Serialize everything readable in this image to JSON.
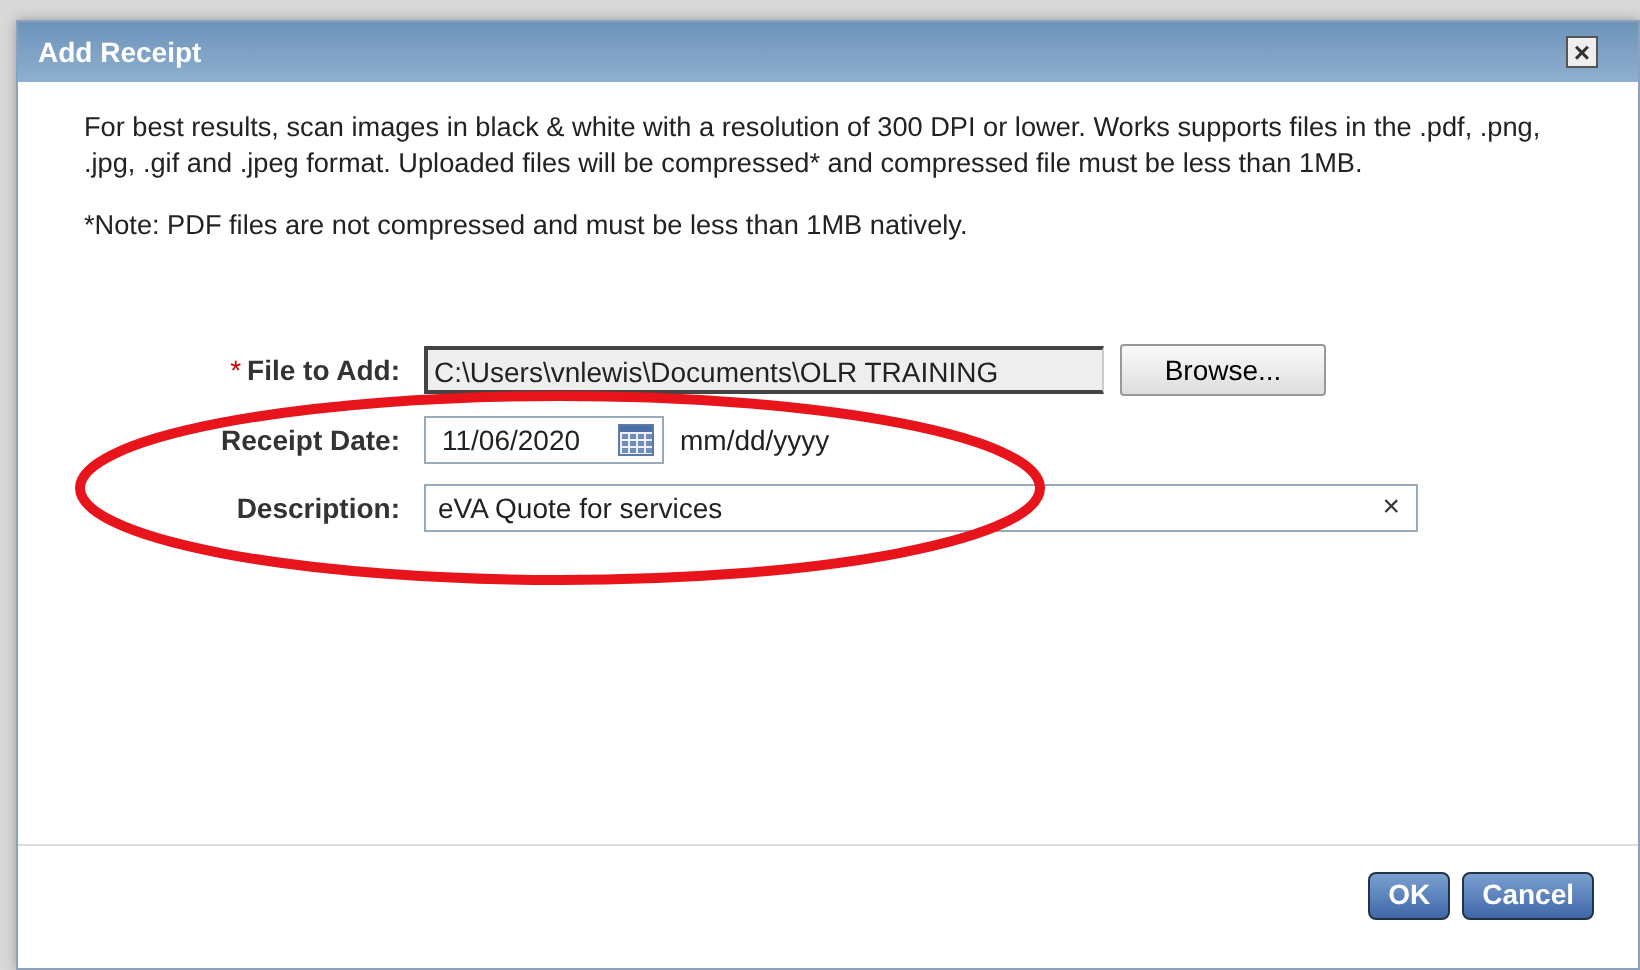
{
  "window": {
    "title": "Add Receipt",
    "close": "×"
  },
  "instructions": [
    "For best results, scan images in black & white with a resolution of 300 DPI or lower. Works supports files in the .pdf, .png, .jpg, .gif and .jpeg format. Uploaded files will be compressed* and compressed file must be less than 1MB.",
    "*Note: PDF files are not compressed and must be less than 1MB natively."
  ],
  "fields": [
    {
      "kind": "file",
      "label": "File to Add:",
      "required_mark": "*",
      "value": "C:\\Users\\vnlewis\\Documents\\OLR TRAINING",
      "button": "Browse..."
    },
    {
      "kind": "date",
      "label": "Receipt Date:",
      "value": "11/06/2020",
      "hint": "mm/dd/yyyy"
    },
    {
      "kind": "text",
      "label": "Description:",
      "value": "eVA Quote for services",
      "clear": "×"
    }
  ],
  "annotation": {
    "kind": "ellipse"
  },
  "buttons": [
    "OK",
    "Cancel"
  ]
}
